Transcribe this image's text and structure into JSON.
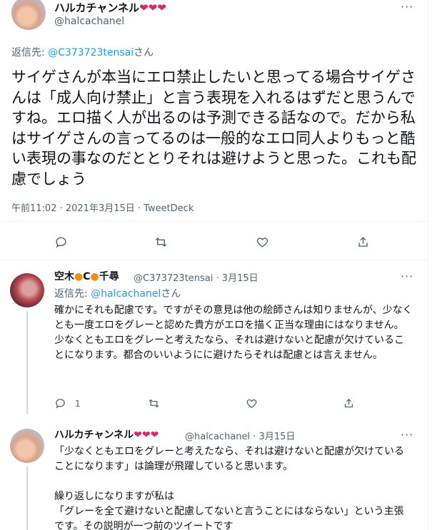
{
  "main_tweet": {
    "author_name": "ハルカチャンネル",
    "author_emoji": "❤❤❤",
    "author_handle": "@halcachanel",
    "reply_to_label": "返信先: ",
    "reply_to_mention": "@C373723tensai",
    "reply_to_suffix": "さん",
    "text": "サイゲさんが本当にエロ禁止したいと思ってる場合サイゲさんは「成人向け禁止」と言う表現を入れるはずだと思うんですね。エロ描く人が出るのは予測できる話なので。だから私はサイゲさんの言ってるのは一般的なエロ同人よりもっと酷い表現の事なのだととりそれは避けようと思った。これも配慮でしょう",
    "meta": "午前11:02 · 2021年3月15日 · TweetDeck",
    "more_icon": "more-icon"
  },
  "reply_1": {
    "author_name_a": "空木",
    "author_name_b": "C",
    "author_name_c": "千尋",
    "author_handle": "@C373723tensai",
    "date": "· 3月15日",
    "reply_to_label": "返信先: ",
    "reply_to_mention": "@halcachanel",
    "reply_to_suffix": "さん",
    "text": "確かにそれも配慮です。ですがその意見は他の絵師さんは知りませんが、少なくとも一度エロをグレーと認めた貴方がエロを描く正当な理由にはなりません。\n少なくともエロをグレーと考えたなら、それは避けないと配慮が欠けていることになります。都合のいいようにに避けたらそれは配慮とは言えません。",
    "reply_count": "1"
  },
  "reply_2": {
    "author_name": "ハルカチャンネル",
    "author_emoji": "❤❤❤",
    "author_handle": "@halcachanel",
    "date": "· 3月15日",
    "text": "「少なくともエロをグレーと考えたなら、それは避けないと配慮が欠けていることになります」は論理が飛躍していると思います。\n\n繰り返しになりますが私は\n「グレーを全て避けないと配慮してないと言うことにはならない」という主張です。その説明が一つ前のツイートです"
  }
}
